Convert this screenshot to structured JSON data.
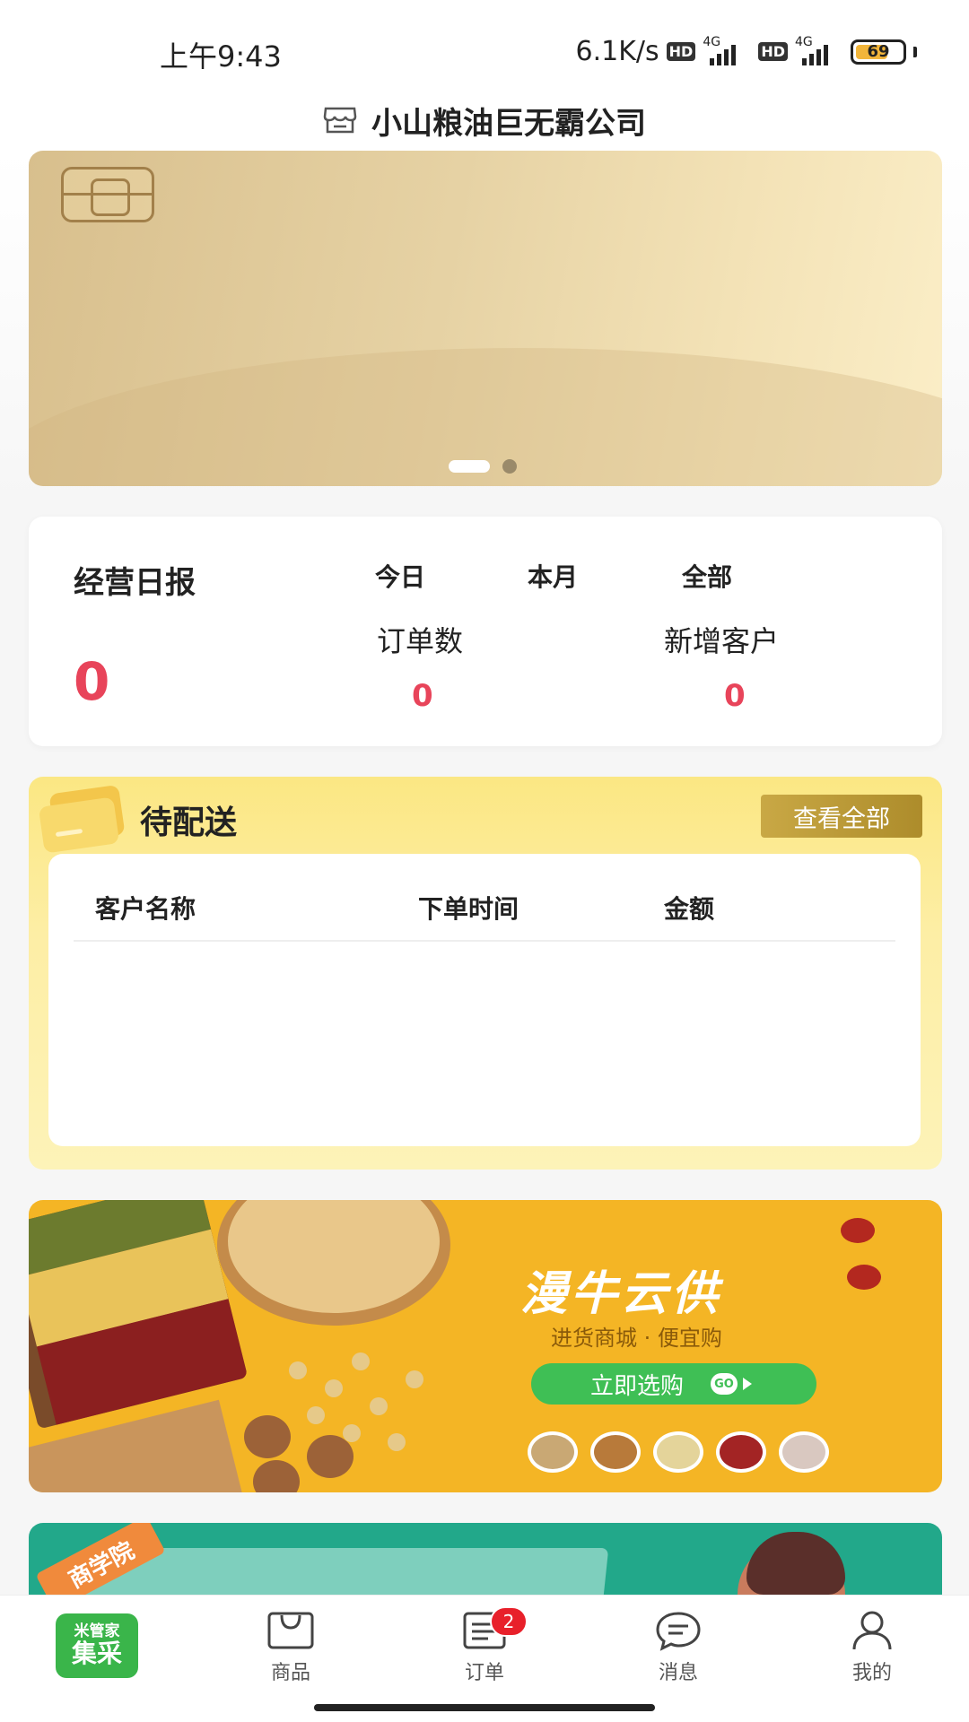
{
  "status_bar": {
    "time": "上午9:43",
    "net_speed": "6.1K/s",
    "hd_label": "HD",
    "network_type": "4G",
    "battery_level": "69"
  },
  "header": {
    "company_name": "小山粮油巨无霸公司"
  },
  "banner": {
    "slide_count": 2,
    "active_slide": 1
  },
  "daily_report": {
    "title": "经营日报",
    "big_value": "0",
    "periods": [
      "今日",
      "本月",
      "全部"
    ],
    "metrics": [
      {
        "label": "订单数",
        "value": "0"
      },
      {
        "label": "新增客户",
        "value": "0"
      }
    ]
  },
  "pending_delivery": {
    "title": "待配送",
    "view_all_label": "查看全部",
    "columns": [
      "客户名称",
      "下单时间",
      "金额"
    ],
    "rows": []
  },
  "promo": {
    "title": "漫牛云供",
    "subtitle": "进货商城 · 便宜购",
    "button_label": "立即选购",
    "go_label": "GO"
  },
  "academy": {
    "tag": "商学院"
  },
  "bottom_nav": {
    "home_logo_line1": "米管家",
    "home_logo_line2": "集采",
    "items": [
      {
        "label": "商品",
        "icon": "shopping-bag-icon"
      },
      {
        "label": "订单",
        "icon": "order-list-icon",
        "badge": "2"
      },
      {
        "label": "消息",
        "icon": "message-icon"
      },
      {
        "label": "我的",
        "icon": "user-icon"
      }
    ]
  },
  "colors": {
    "accent_red": "#e8445a",
    "brand_green": "#3ab54a",
    "gold_button": "#b89a3a",
    "promo_yellow": "#f4b525"
  }
}
